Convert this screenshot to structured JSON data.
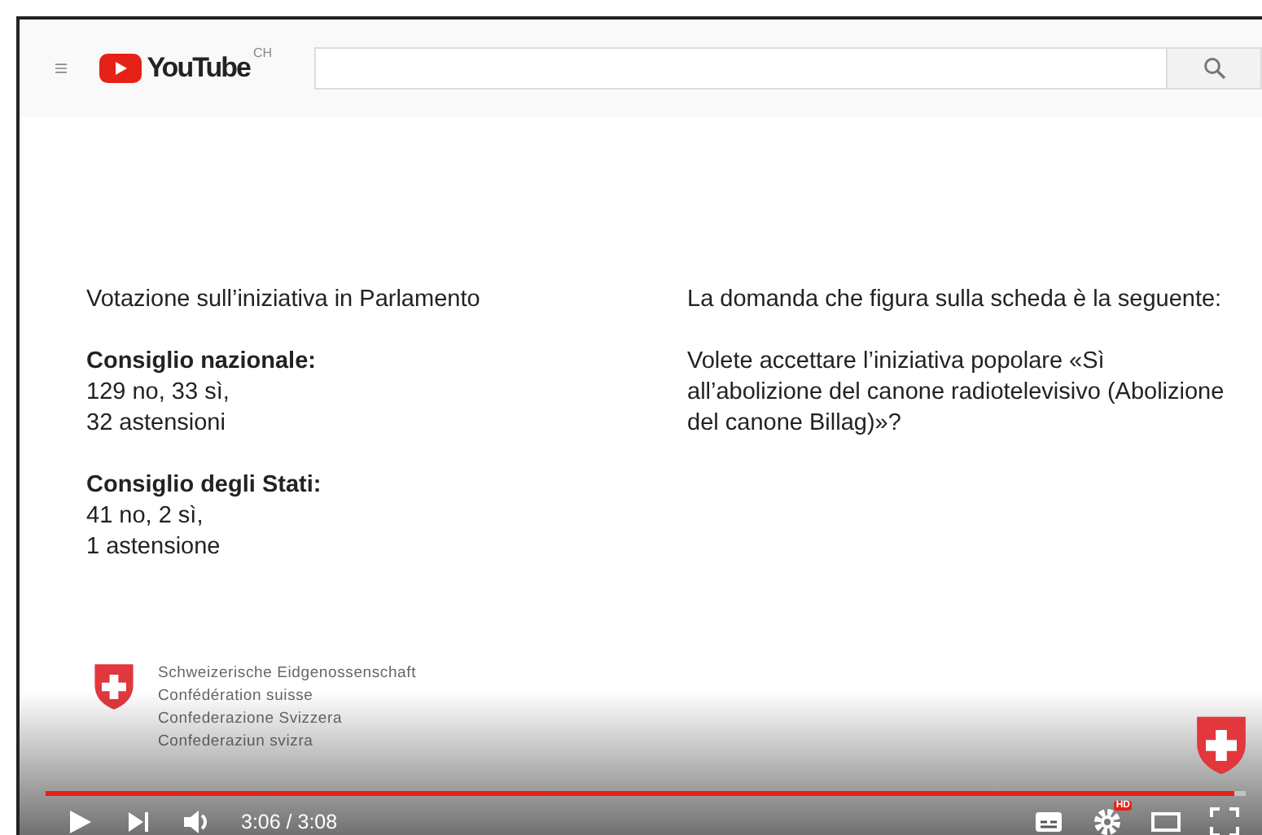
{
  "header": {
    "logo": "YouTube",
    "region": "CH"
  },
  "slide": {
    "left": [
      {
        "kind": "text",
        "text": "Votazione sull’iniziativa in Parlamento"
      },
      {
        "kind": "heading",
        "text": "Consiglio nazionale:"
      },
      {
        "kind": "text",
        "text": "129 no, 33 sì,"
      },
      {
        "kind": "text",
        "text": "32 astensioni"
      },
      {
        "kind": "heading",
        "text": "Consiglio degli Stati:"
      },
      {
        "kind": "text",
        "text": "41 no, 2 sì,"
      },
      {
        "kind": "text",
        "text": "1 astensione"
      }
    ],
    "right": [
      "La domanda che figura sulla scheda è la seguente:",
      "Volete accettare l’iniziativa popolare «Sì all’abolizione del canone radiotelevisivo (Abolizione del canone Billag)»?"
    ],
    "emblem_lines": [
      "Schweizerische Eidgenossenschaft",
      "Confédération suisse",
      "Confederazione Svizzera",
      "Confederaziun svizra"
    ]
  },
  "player": {
    "level": 0.99,
    "time": "3:06 / 3:08",
    "hd": "HD"
  }
}
